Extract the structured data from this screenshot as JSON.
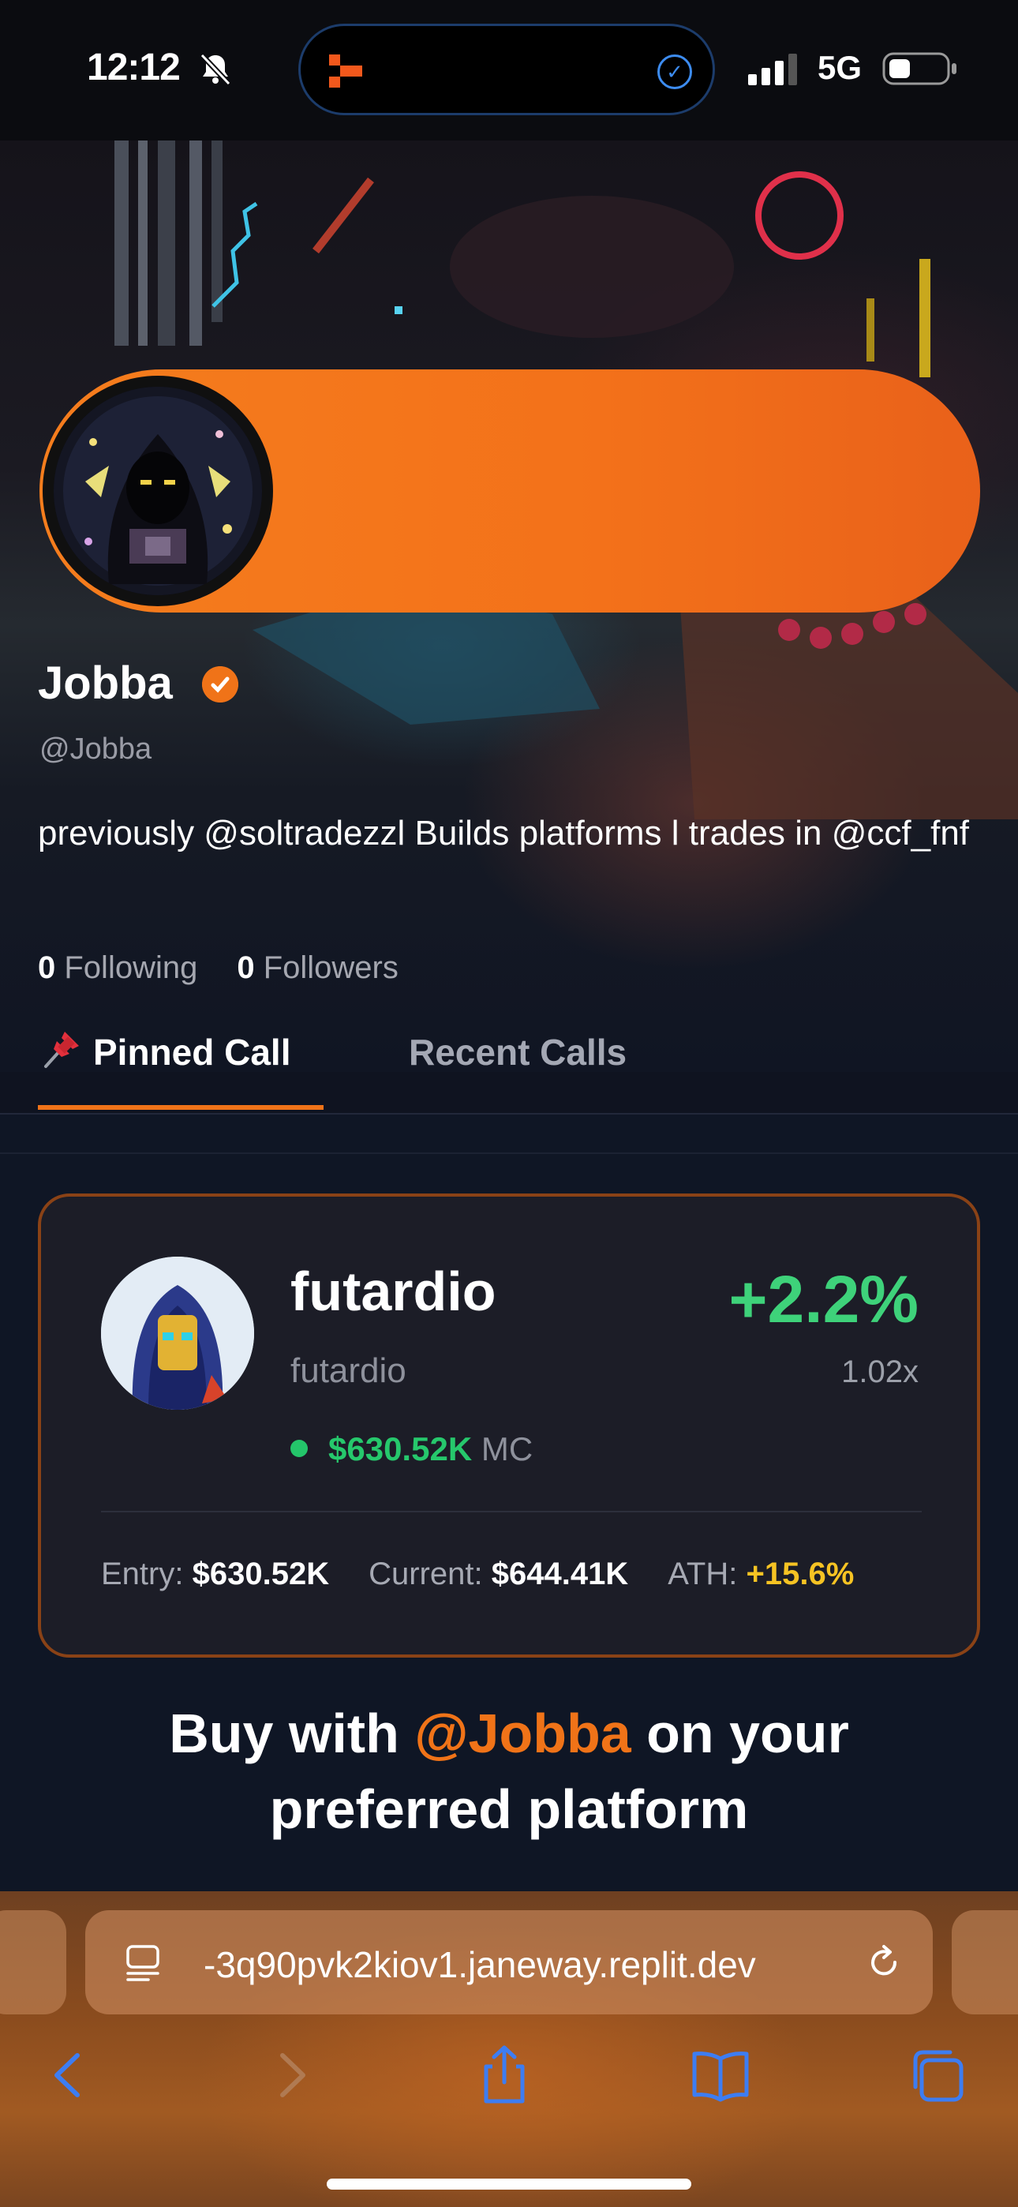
{
  "status_bar": {
    "time": "12:12",
    "network": "5G",
    "icons": [
      "bell-slash-icon",
      "app-logo-icon",
      "check-circle-icon",
      "signal-bars-icon",
      "battery-icon"
    ]
  },
  "profile": {
    "name": "Jobba",
    "handle": "@Jobba",
    "bio": "previously @soltradezzl Builds platforms l trades in @ccf_fnf",
    "following_count": "0",
    "following_label": "Following",
    "followers_count": "0",
    "followers_label": "Followers",
    "accent_color": "#f07318"
  },
  "tabs": [
    {
      "label": "Pinned Call",
      "active": true,
      "icon": "pushpin-icon"
    },
    {
      "label": "Recent Calls",
      "active": false
    }
  ],
  "pinned_call": {
    "token_name": "futardio",
    "token_ticker": "futardio",
    "market_cap": "$630.52K",
    "market_cap_suffix": "MC",
    "change_pct": "+2.2%",
    "multiplier": "1.02x",
    "entry_label": "Entry:",
    "entry_value": "$630.52K",
    "current_label": "Current:",
    "current_value": "$644.41K",
    "ath_label": "ATH:",
    "ath_value": "+15.6%"
  },
  "cta": {
    "prefix": "Buy with",
    "handle": "@Jobba",
    "suffix_line1": "on your",
    "line2": "preferred platform"
  },
  "browser": {
    "url": "-3q90pvk2kiov1.janeway.replit.dev",
    "nav_icons": [
      "back-icon",
      "forward-icon",
      "share-icon",
      "bookmarks-icon",
      "tabs-icon"
    ]
  }
}
